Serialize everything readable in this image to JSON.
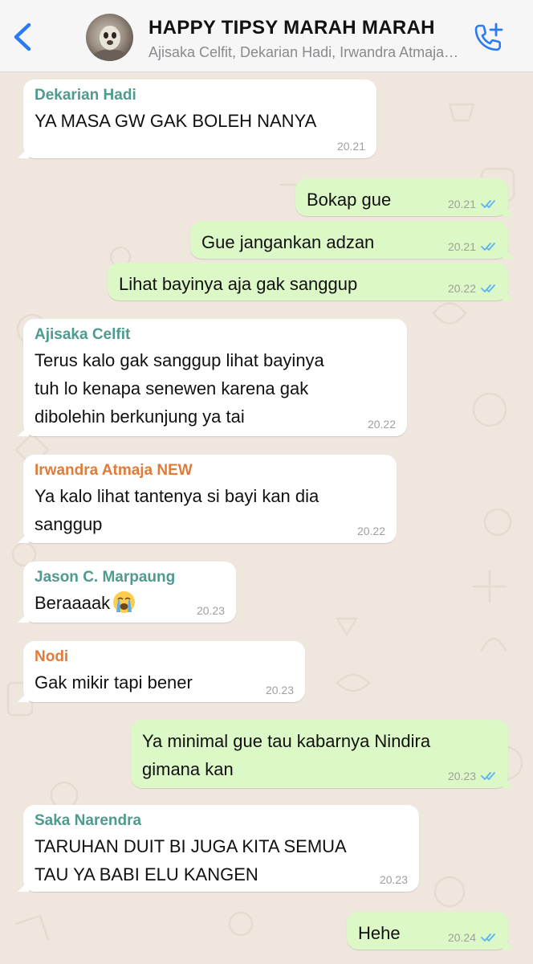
{
  "header": {
    "title": "HAPPY TIPSY MARAH MARAH",
    "subtitle": "Ajisaka Celfit, Dekarian Hadi, Irwandra Atmaja NEW, Jason C. Marpaung, Nodi, Saka Narendra, You",
    "back_icon": "chevron-left-icon",
    "call_icon": "add-call-icon",
    "accent": "#2a7af2"
  },
  "colors": {
    "incoming_bubble": "#ffffff",
    "outgoing_bubble": "#dcf8c6",
    "read_ticks": "#5ab4f4",
    "wallpaper": "#efe7de"
  },
  "messages": [
    {
      "direction": "in",
      "sender": "Dekarian Hadi",
      "sender_color": "#4f9a8f",
      "lines": [
        "YA MASA GW GAK BOLEH NANYA"
      ],
      "time": "20.21"
    },
    {
      "direction": "out",
      "lines": [
        "Bokap gue"
      ],
      "time": "20.21",
      "status": "read"
    },
    {
      "direction": "out",
      "lines": [
        "Gue jangankan adzan"
      ],
      "time": "20.21",
      "status": "read"
    },
    {
      "direction": "out",
      "lines": [
        "Lihat bayinya aja gak sanggup"
      ],
      "time": "20.22",
      "status": "read"
    },
    {
      "direction": "in",
      "sender": "Ajisaka Celfit",
      "sender_color": "#4f9a8f",
      "lines": [
        "Terus kalo gak sanggup lihat bayinya",
        "tuh lo kenapa senewen karena gak",
        "dibolehin berkunjung ya tai"
      ],
      "time": "20.22"
    },
    {
      "direction": "in",
      "sender": "Irwandra Atmaja NEW",
      "sender_color": "#e07b39",
      "lines": [
        "Ya kalo lihat tantenya si bayi kan dia",
        "sanggup"
      ],
      "time": "20.22"
    },
    {
      "direction": "in",
      "sender": "Jason C. Marpaung",
      "sender_color": "#4f9a8f",
      "lines": [
        "Beraaaak"
      ],
      "emoji": "loudly-crying-face-emoji",
      "time": "20.23"
    },
    {
      "direction": "in",
      "sender": "Nodi",
      "sender_color": "#e07b39",
      "lines": [
        "Gak mikir tapi bener"
      ],
      "time": "20.23"
    },
    {
      "direction": "out",
      "lines": [
        "Ya minimal gue tau kabarnya Nindira",
        "gimana kan"
      ],
      "time": "20.23",
      "status": "read"
    },
    {
      "direction": "in",
      "sender": "Saka Narendra",
      "sender_color": "#4f9a8f",
      "lines": [
        "TARUHAN DUIT BI JUGA KITA SEMUA",
        "TAU YA BABI ELU KANGEN"
      ],
      "time": "20.23"
    },
    {
      "direction": "out",
      "lines": [
        "Hehe"
      ],
      "time": "20.24",
      "status": "read"
    }
  ]
}
